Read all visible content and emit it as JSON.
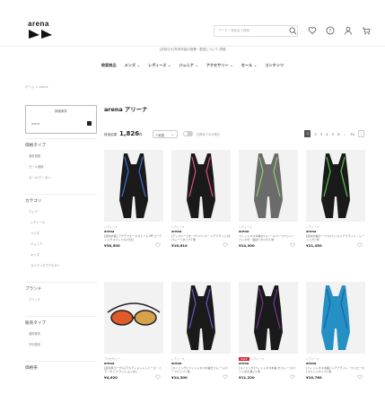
{
  "header": {
    "logo": "arena",
    "search_placeholder": "ワード・商品名で検索",
    "icons": [
      "search-icon",
      "heart-icon",
      "help-icon",
      "user-icon",
      "cart-icon"
    ]
  },
  "notice": "[お知らせ]年末年始の営業・配送について 詳細",
  "gnav": [
    "検索商品",
    "メンズ",
    "レディース",
    "ジュニア",
    "アクセサリー",
    "セール",
    "コンテンツ"
  ],
  "breadcrumb": "ホーム > arena",
  "sidebar": {
    "box_title": "検索条件",
    "box_value": "arena",
    "sections": [
      {
        "title": "価格タイプ",
        "items": [
          "通常価格",
          "セール価格",
          "セール/クーポン"
        ]
      },
      {
        "title": "カテゴリ",
        "items": [
          "ウェア",
          "レディース",
          "メンズ",
          "ジュニア",
          "キッズ",
          "スイミングアクセサリ"
        ]
      },
      {
        "title": "ブランド",
        "items": [
          "アリーナ"
        ]
      },
      {
        "title": "販売タイプ",
        "items": [
          "通常販売",
          "予約販売"
        ]
      },
      {
        "title": "価格帯",
        "items": []
      }
    ]
  },
  "main": {
    "title": "arena アリーナ",
    "count_label": "検索結果",
    "count": "1,826",
    "count_unit": "件",
    "sort": "人気順",
    "toggle_label": "在庫ありのみ表示",
    "pages": [
      "1",
      "2",
      "3",
      "4",
      "5",
      "6",
      "...",
      "30"
    ],
    "products": [
      {
        "meta": "レディース",
        "brand": "arena",
        "name": "[競泳水着] アクアフォースストーム MFコーティングスパッツ(ひざ丈)",
        "price": "¥38,500",
        "color": "#1a1a1a",
        "accent": "#3b6fd9"
      },
      {
        "meta": "レディース",
        "brand": "arena",
        "name": "[ディズニー] オープンバック・ニアブライト(セパレーツタイプ) 他",
        "price": "¥16,610",
        "color": "#1a1a1a",
        "accent": "#e04f7a"
      },
      {
        "meta": "レディース",
        "brand": "arena",
        "name": "フィットネス水着セパレート(ハーフパンツ・パッド付・脇ぽっちゃり) 他",
        "price": "¥14,300",
        "color": "#6b6b6b",
        "accent": "#8bcf6a"
      },
      {
        "meta": "レディース",
        "brand": "arena",
        "name": "[競泳水着]ハーフスパッツ(ニアブライト・レーシング) 他",
        "price": "¥21,450",
        "color": "#1a1a1a",
        "accent": "#58c44c"
      },
      {
        "meta": "アクセサリー",
        "brand": "arena",
        "name": "[競泳用ゴーグル]アルティメットシリーズ・ミラータイプ クッションなし",
        "price": "¥4,620",
        "color": "#d6a24a",
        "accent": "#e05a2a"
      },
      {
        "meta": "レディース",
        "brand": "arena",
        "name": "[スイミング] フィットネス水着セパレート(ハーフパンツ) 他",
        "price": "¥14,300",
        "color": "#1a1a1a",
        "accent": "#6a54c8"
      },
      {
        "meta": "レディース",
        "brand": "arena",
        "name": "[スイミング]フィットネス水着 セパレーツ(パンツ丈の長い) 他",
        "price": "¥11,220",
        "color": "#1a1a1a",
        "accent": "#7d2f9c",
        "badge": "SALE"
      },
      {
        "meta": "レディース",
        "brand": "arena",
        "name": "[フィットネス水着] ニアブライト・ワンピース(スパッツタイプ) 他",
        "price": "¥10,780",
        "color": "#2590c4",
        "accent": "#1d5fa8"
      }
    ]
  }
}
